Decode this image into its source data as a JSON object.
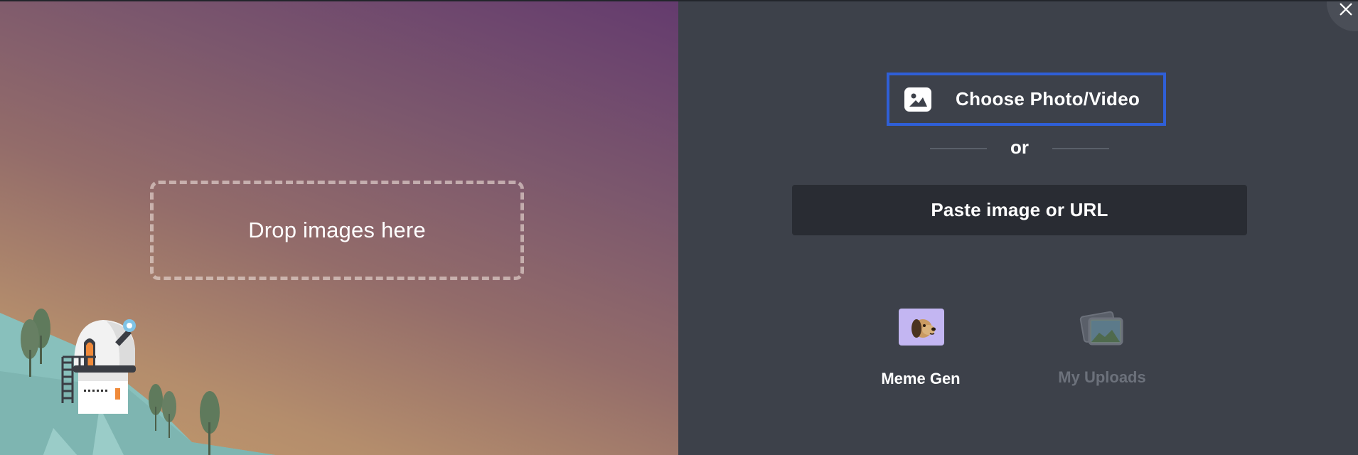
{
  "dropzone": {
    "text": "Drop images here"
  },
  "upload": {
    "choose_label": "Choose Photo/Video",
    "divider_text": "or",
    "paste_label": "Paste image or URL"
  },
  "tiles": {
    "meme_gen": {
      "label": "Meme Gen",
      "icon": "dog-icon"
    },
    "my_uploads": {
      "label": "My Uploads",
      "icon": "photo-stack-icon"
    }
  },
  "icons": {
    "choose": "image-icon",
    "close": "close-icon"
  },
  "colors": {
    "accent": "#2f5fd7",
    "panel_bg": "#3d414a",
    "paste_bg": "#292c33",
    "meme_tile_bg": "#c3b6f2",
    "disabled_text": "#6c717b"
  }
}
